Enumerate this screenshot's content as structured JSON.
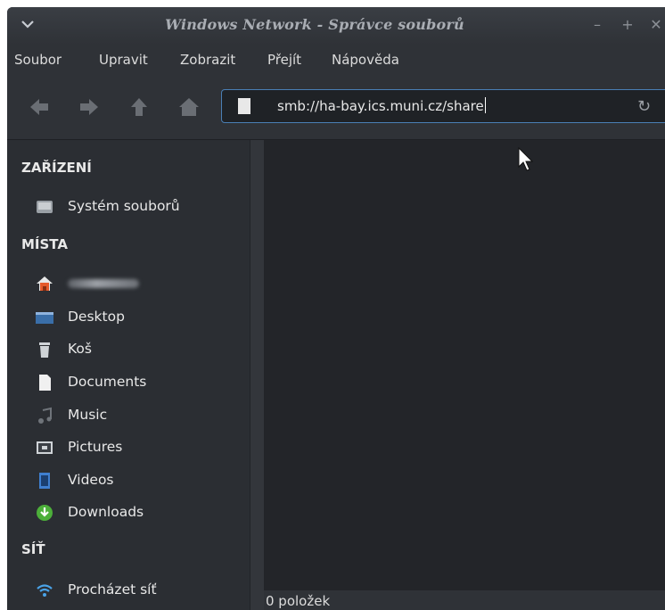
{
  "window": {
    "title": "Windows Network - Správce souborů"
  },
  "menu": [
    "Soubor",
    "Upravit",
    "Zobrazit",
    "Přejít",
    "Nápověda"
  ],
  "location": {
    "path": "smb://ha-bay.ics.muni.cz/share"
  },
  "sidebar": {
    "devices": {
      "heading": "ZAŘÍZENÍ",
      "items": [
        {
          "label": "Systém souborů",
          "icon": "drive-icon"
        }
      ]
    },
    "places": {
      "heading": "MÍSTA",
      "items": [
        {
          "label": "Desktop",
          "icon": "desktop-icon"
        },
        {
          "label": "Koš",
          "icon": "trash-icon"
        },
        {
          "label": "Documents",
          "icon": "document-icon"
        },
        {
          "label": "Music",
          "icon": "music-icon"
        },
        {
          "label": "Pictures",
          "icon": "picture-icon"
        },
        {
          "label": "Videos",
          "icon": "video-icon"
        },
        {
          "label": "Downloads",
          "icon": "download-icon"
        }
      ]
    },
    "network": {
      "heading": "SÍŤ",
      "items": [
        {
          "label": "Procházet síť",
          "icon": "wifi-icon"
        }
      ]
    }
  },
  "status": {
    "text": "0 položek"
  },
  "colors": {
    "accent": "#4a7fb5",
    "background": "#2b2e33",
    "content": "#232529"
  }
}
